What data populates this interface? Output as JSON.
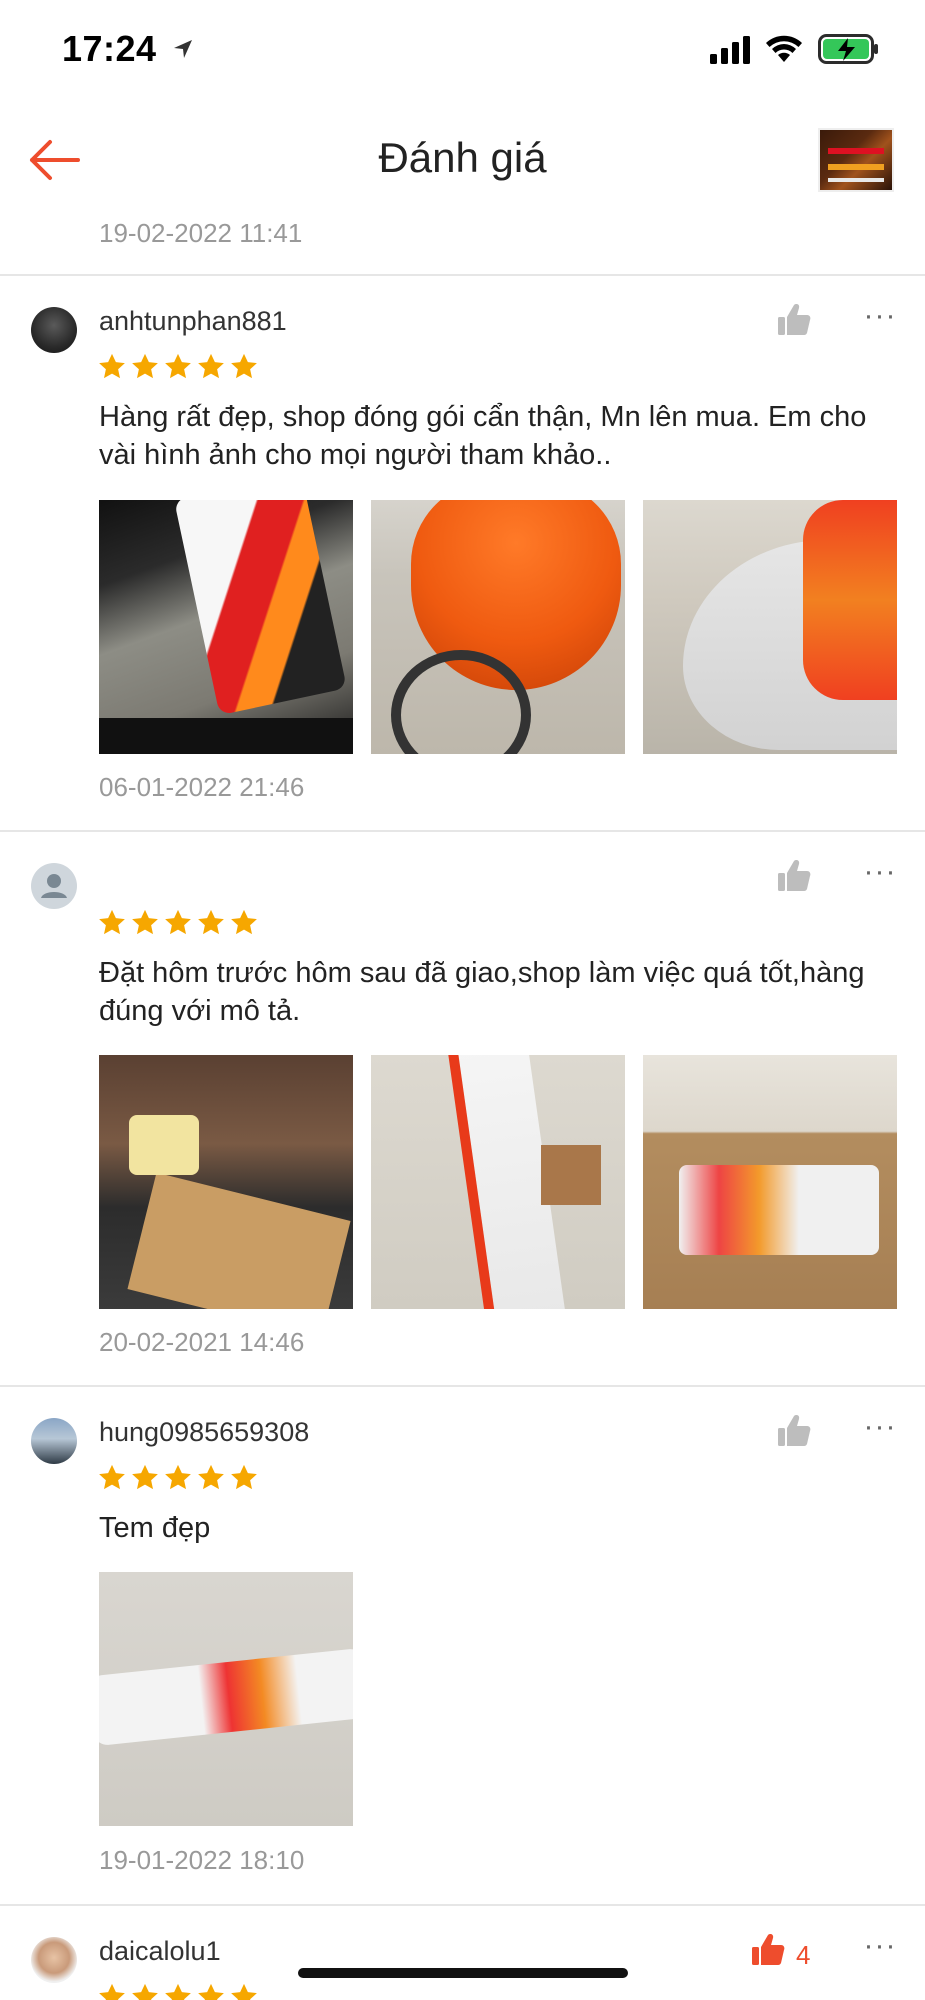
{
  "status_bar": {
    "time": "17:24"
  },
  "header": {
    "title": "Đánh giá"
  },
  "top_date": "19-02-2022 11:41",
  "reviews": [
    {
      "username": "anhtunphan881",
      "rating": 5,
      "comment": "Hàng rất đẹp, shop đóng gói cẩn thận, Mn lên mua. Em cho vài hình ảnh cho mọi người tham khảo..",
      "date": "06-01-2022 21:46",
      "photos": [
        "motorbike-side-decal",
        "motorbike-front-orange",
        "motorbike-honda-logo"
      ]
    },
    {
      "username": "",
      "rating": 5,
      "comment": "Đặt hôm trước hôm sau đã giao,shop làm việc quá tốt,hàng đúng với mô tả.",
      "date": "20-02-2021 14:46",
      "photos": [
        "package-box",
        "decal-roll",
        "decal-in-box"
      ]
    },
    {
      "username": "hung0985659308",
      "rating": 5,
      "comment": "Tem đẹp",
      "date": "19-01-2022 18:10",
      "photos": [
        "decal-roll-plastic"
      ]
    },
    {
      "username": "daicalolu1",
      "rating": 5,
      "like_count": "4",
      "liked": true
    }
  ],
  "colors": {
    "accent": "#ee4d2d",
    "star": "#f6a700",
    "muted": "#999999"
  }
}
